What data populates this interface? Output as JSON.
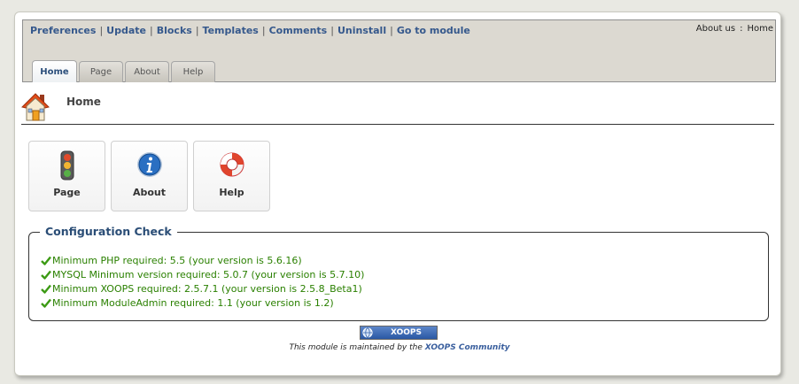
{
  "admin_menu": {
    "links": [
      "Preferences",
      "Update",
      "Blocks",
      "Templates",
      "Comments",
      "Uninstall",
      "Go to module"
    ],
    "separator": "|"
  },
  "about_links": {
    "about": "About us",
    "separator": ":",
    "home": "Home"
  },
  "tabs": [
    {
      "label": "Home",
      "active": true
    },
    {
      "label": "Page",
      "active": false
    },
    {
      "label": "About",
      "active": false
    },
    {
      "label": "Help",
      "active": false
    }
  ],
  "page": {
    "title": "Home",
    "icon": "home-icon"
  },
  "tiles": [
    {
      "label": "Page",
      "icon": "traffic-light-icon"
    },
    {
      "label": "About",
      "icon": "info-icon"
    },
    {
      "label": "Help",
      "icon": "lifebuoy-icon"
    }
  ],
  "config_check": {
    "title": "Configuration Check",
    "items": [
      "Minimum PHP required: 5.5 (your version is 5.6.16)",
      "MYSQL Minimum version required: 5.0.7 (your version is 5.7.10)",
      "Minimum XOOPS required: 2.5.7.1 (your version is 2.5.8_Beta1)",
      "Minimum ModuleAdmin required: 1.1 (your version is 1.2)"
    ],
    "status_color": "#2a8000"
  },
  "footer": {
    "badge": "XOOPS",
    "maintained_prefix": "This module is maintained by the",
    "maintained_link": "XOOPS Community"
  },
  "colors": {
    "link": "#35588c",
    "accent": "#2a4d76",
    "check": "#2a8000"
  }
}
